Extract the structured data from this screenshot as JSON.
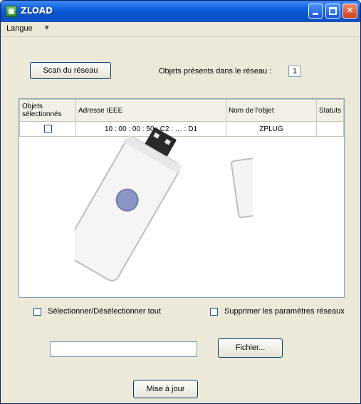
{
  "window": {
    "title": "ZLOAD"
  },
  "menu": {
    "langue": "Langue",
    "langue_arrow": "▾"
  },
  "scan_button": "Scan du réseau",
  "objects_count": {
    "label": "Objets présents dans le réseau :",
    "value": "1"
  },
  "table": {
    "headers": [
      "Objets sélectionnés",
      "Adresse IEEE",
      "Nom de l'objet",
      "Statuts"
    ],
    "rows": [
      {
        "selected": false,
        "ieee": "10 : 00 : 00 : 50 : C2 : … : D1",
        "name": "ZPLUG",
        "status": ""
      }
    ]
  },
  "select_all_label": "Sélectionner/Désélectionner tout",
  "delete_network_params_label": "Supprimer les paramètres réseaux",
  "file_input": {
    "value": ""
  },
  "file_button": "Fichier...",
  "update_button": "Mise à jour",
  "colors": {
    "titlebar": "#0b4fc3",
    "window_bg": "#ece9d8",
    "close_button": "#d2401e"
  }
}
